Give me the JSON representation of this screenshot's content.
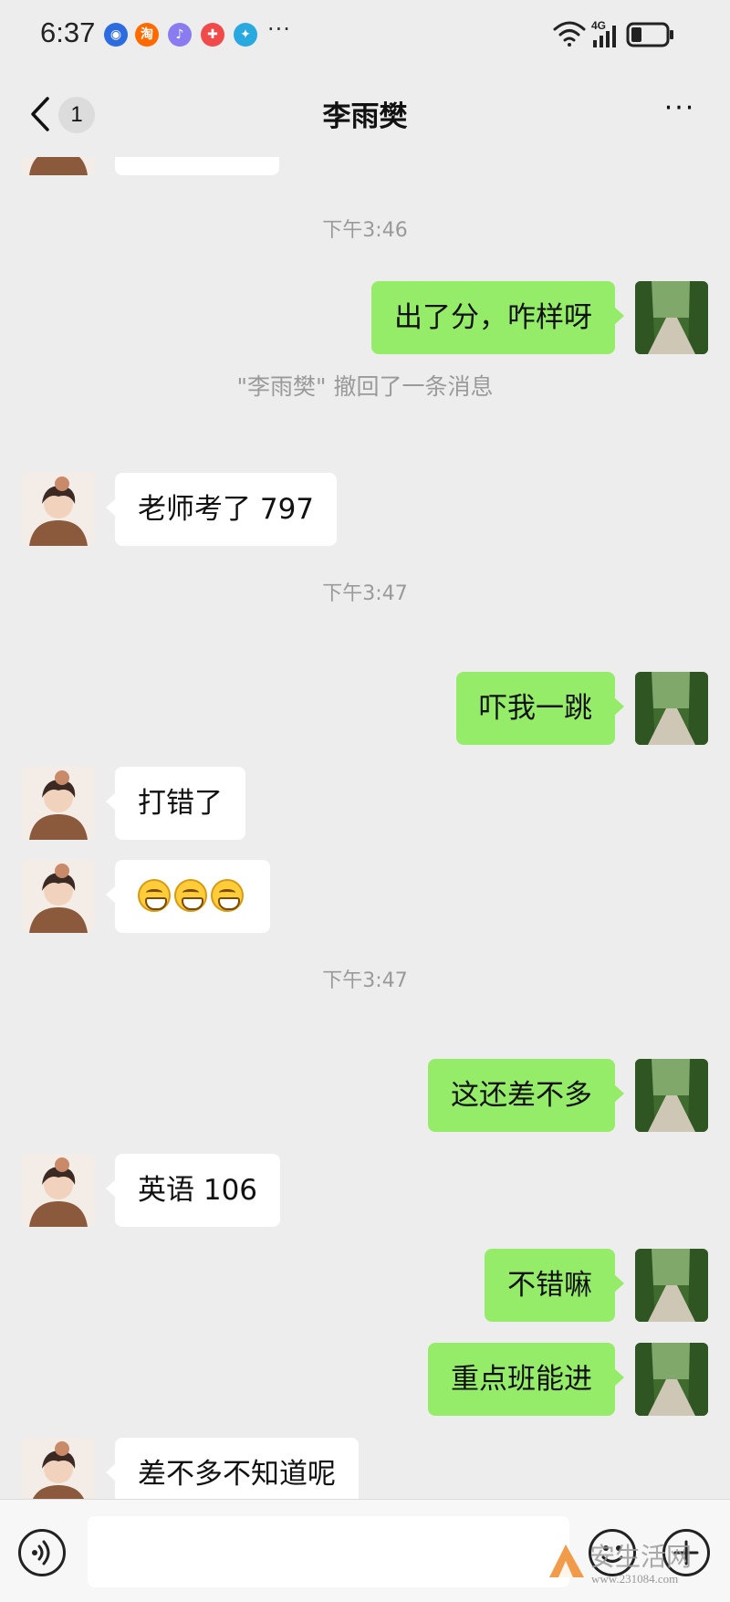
{
  "status_bar": {
    "time": "6:37",
    "apps": [
      {
        "icon": "blue-app-icon",
        "color": "#2d6ce0",
        "glyph": "◉"
      },
      {
        "icon": "taobao-icon",
        "color": "#ff6a00",
        "glyph": "淘"
      },
      {
        "icon": "music-icon",
        "color": "#8a7cf0",
        "glyph": "♪"
      },
      {
        "icon": "colorful-app-icon",
        "color": "#f04a4a",
        "glyph": "✚"
      },
      {
        "icon": "globe-app-icon",
        "color": "#2aa8e0",
        "glyph": "✦"
      }
    ],
    "more": "···",
    "network": "4G",
    "battery_level": 0.3
  },
  "header": {
    "back_count": "1",
    "title": "李雨樊",
    "more": "···"
  },
  "messages": [
    {
      "type": "time",
      "text": "下午3:46"
    },
    {
      "type": "out",
      "text": "出了分，咋样呀"
    },
    {
      "type": "recall",
      "text": "\"李雨樊\" 撤回了一条消息"
    },
    {
      "type": "in",
      "text": "老师考了 797"
    },
    {
      "type": "time",
      "text": "下午3:47"
    },
    {
      "type": "out",
      "text": "吓我一跳"
    },
    {
      "type": "in",
      "text": "打错了"
    },
    {
      "type": "in",
      "emojis": [
        "grin-emoji",
        "grin-emoji",
        "grin-emoji"
      ]
    },
    {
      "type": "time",
      "text": "下午3:47"
    },
    {
      "type": "out",
      "text": "这还差不多"
    },
    {
      "type": "in",
      "text": "英语 106"
    },
    {
      "type": "out",
      "text": "不错嘛"
    },
    {
      "type": "out",
      "text": "重点班能进"
    },
    {
      "type": "in",
      "text": "差不多不知道呢"
    }
  ],
  "input_bar": {
    "placeholder": "",
    "voice_icon": "voice-icon",
    "emoji_icon": "emoji-icon",
    "plus_icon": "plus-icon"
  },
  "watermark": {
    "text": "安生活网",
    "url": "www.231084.com"
  },
  "colors": {
    "background": "#ededed",
    "outgoing_bubble": "#95ec69",
    "incoming_bubble": "#ffffff"
  }
}
